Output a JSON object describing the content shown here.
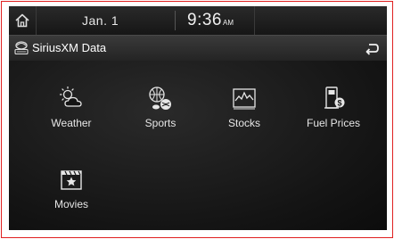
{
  "statusbar": {
    "date": "Jan.  1",
    "time": "9:36",
    "ampm": "AM"
  },
  "titlebar": {
    "title": "SiriusXM Data"
  },
  "menu": {
    "items": [
      {
        "label": "Weather",
        "icon": "weather-icon"
      },
      {
        "label": "Sports",
        "icon": "sports-icon"
      },
      {
        "label": "Stocks",
        "icon": "stocks-icon"
      },
      {
        "label": "Fuel Prices",
        "icon": "fuel-prices-icon"
      },
      {
        "label": "Movies",
        "icon": "movies-icon"
      }
    ]
  },
  "colors": {
    "frame_border": "#e02020",
    "background": "#101010",
    "text": "#e6e6e6"
  }
}
